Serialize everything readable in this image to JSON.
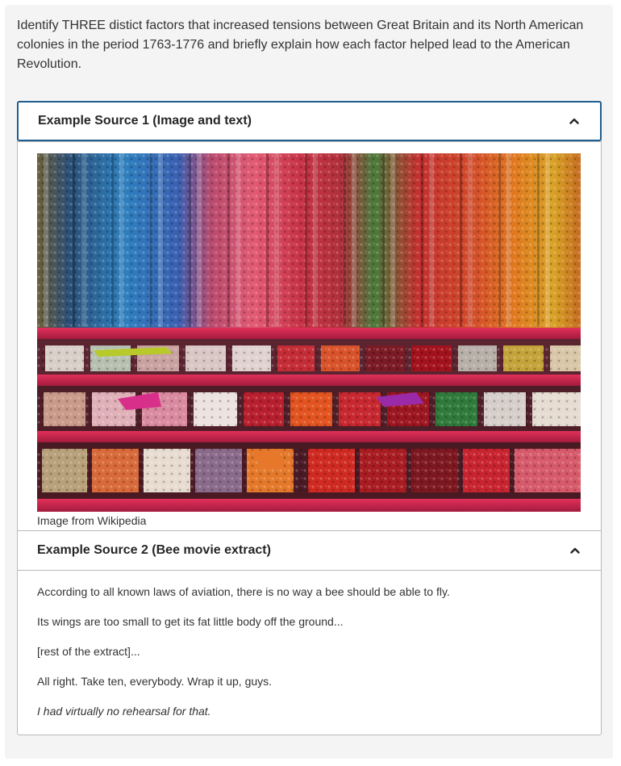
{
  "question": {
    "text": "Identify THREE distict factors that increased tensions between Great Britain and its North American colonies in the period 1763-1776 and briefly explain how each factor helped lead to the American Revolution."
  },
  "sources": [
    {
      "title": "Example Source 1 (Image and text)",
      "expanded": true,
      "image_alt": "Candy store wall with tubes and bins of colorful sweets",
      "caption": "Image from Wikipedia",
      "toggle_icon": "chevron-up-icon"
    },
    {
      "title": "Example Source 2 (Bee movie extract)",
      "expanded": true,
      "toggle_icon": "chevron-up-icon",
      "paragraphs": [
        "According to all known laws of aviation, there is no way a bee should be able to fly.",
        "Its wings are too small to get its fat little body off the ground...",
        "[rest of the extract]...",
        "All right. Take ten, everybody. Wrap it up, guys."
      ],
      "italic_paragraph": "I had virtually no rehearsal for that."
    }
  ],
  "colors": {
    "focus_border": "#1f5e8f",
    "panel_border": "#b9b9b9",
    "page_background": "#f4f4f4"
  }
}
